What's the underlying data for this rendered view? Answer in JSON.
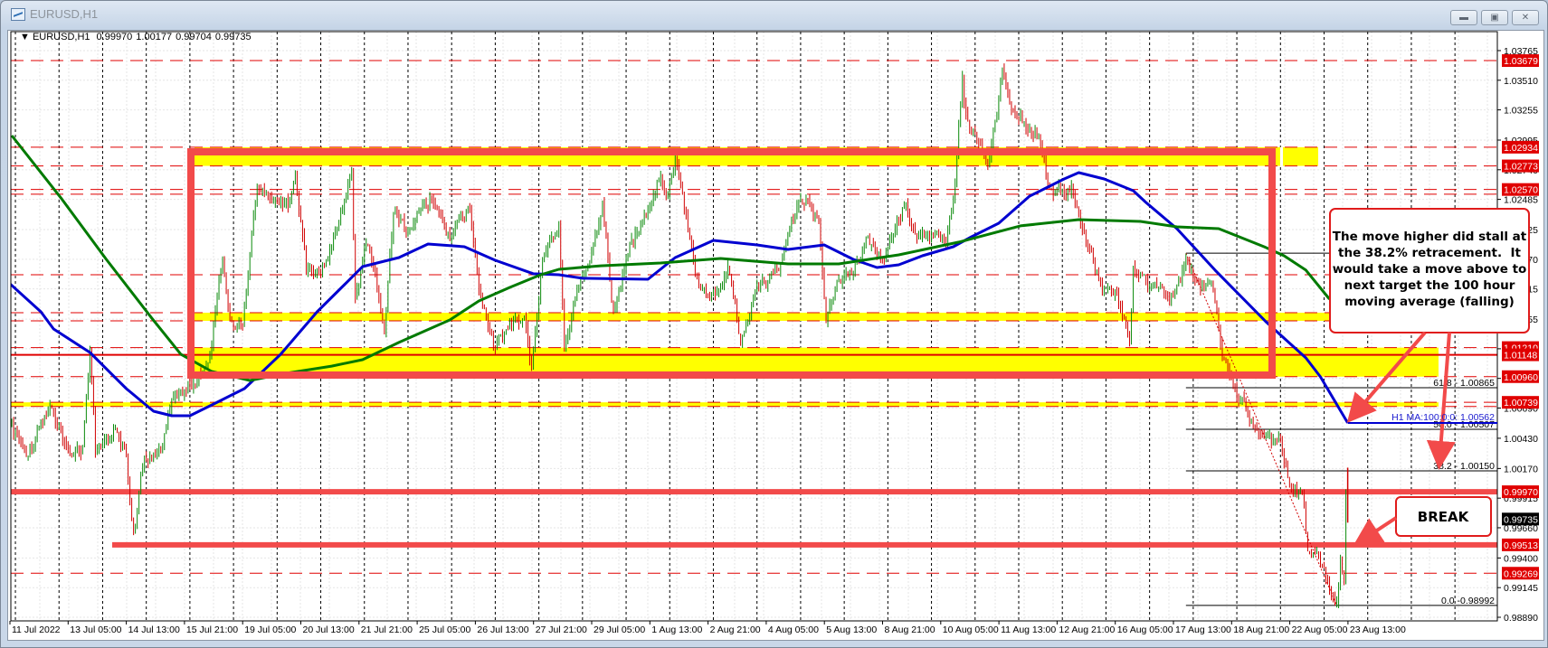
{
  "window": {
    "title": "EURUSD,H1",
    "buttons": {
      "minimize": "minimize-icon",
      "maximize": "maximize-icon",
      "close": "close-icon"
    }
  },
  "chart_data": {
    "type": "bar",
    "bar_style": "ohlc",
    "symbol": "EURUSD,H1",
    "header": {
      "symbol": "EURUSD,H1",
      "open": "0.99970",
      "high": "1.00177",
      "low": "0.99704",
      "close": "0.99735"
    },
    "last_bar": {
      "time": "2022-08-23 13:00",
      "open": 0.9997,
      "high": 1.00177,
      "low": 0.99704,
      "close": 0.99735
    },
    "colors": {
      "up": "#0a8a0a",
      "down": "#d00000",
      "ma100": "#0000d0",
      "ma200": "#007a00",
      "level": "#e00000",
      "zone": "#ffff00",
      "annotation": "#f24a4a"
    },
    "ylim": [
      0.9889,
      1.03765
    ],
    "y_ticks": [
      "1.03765",
      "1.03510",
      "1.03255",
      "1.02995",
      "1.02740",
      "1.02485",
      "1.02225",
      "1.01970",
      "1.01715",
      "1.01455",
      "1.01200",
      "1.00945",
      "1.00690",
      "1.00430",
      "1.00170",
      "0.99915",
      "0.99660",
      "0.99400",
      "0.99145",
      "0.98890"
    ],
    "x_ticks": [
      "11 Jul 2022",
      "13 Jul 05:00",
      "14 Jul 13:00",
      "15 Jul 21:00",
      "19 Jul 05:00",
      "20 Jul 13:00",
      "21 Jul 21:00",
      "25 Jul 05:00",
      "26 Jul 13:00",
      "27 Jul 21:00",
      "29 Jul 05:00",
      "1 Aug 13:00",
      "2 Aug 21:00",
      "4 Aug 05:00",
      "5 Aug 13:00",
      "8 Aug 21:00",
      "10 Aug 05:00",
      "11 Aug 13:00",
      "12 Aug 21:00",
      "16 Aug 05:00",
      "17 Aug 13:00",
      "18 Aug 21:00",
      "22 Aug 05:00",
      "23 Aug 13:00"
    ],
    "grid": true,
    "period_separators": true,
    "price_path": [
      [
        "2022-07-11 21:00",
        1.00546
      ],
      [
        "2022-07-12 06:00",
        1.00274
      ],
      [
        "2022-07-12 19:00",
        1.00702
      ],
      [
        "2022-07-13 05:00",
        1.00313
      ],
      [
        "2022-07-13 13:00",
        1.00352
      ],
      [
        "2022-07-13 17:00",
        1.01168
      ],
      [
        "2022-07-13 20:00",
        1.00313
      ],
      [
        "2022-07-14 06:00",
        1.00507
      ],
      [
        "2022-07-14 13:00",
        1.00274
      ],
      [
        "2022-07-14 17:00",
        0.99613
      ],
      [
        "2022-07-14 23:00",
        1.00274
      ],
      [
        "2022-07-15 08:00",
        1.00313
      ],
      [
        "2022-07-15 15:00",
        1.00779
      ],
      [
        "2022-07-18 03:00",
        1.00896
      ],
      [
        "2022-07-18 11:00",
        1.01129
      ],
      [
        "2022-07-18 15:00",
        1.01635
      ],
      [
        "2022-07-18 18:00",
        1.01946
      ],
      [
        "2022-07-18 22:00",
        1.0144
      ],
      [
        "2022-07-19 05:00",
        1.01401
      ],
      [
        "2022-07-19 11:00",
        1.02334
      ],
      [
        "2022-07-19 13:00",
        1.02606
      ],
      [
        "2022-07-19 21:00",
        1.02451
      ],
      [
        "2022-07-20 06:00",
        1.02412
      ],
      [
        "2022-07-20 10:00",
        1.02684
      ],
      [
        "2022-07-20 16:00",
        1.01868
      ],
      [
        "2022-07-21 00:00",
        1.01829
      ],
      [
        "2022-07-21 09:00",
        1.02218
      ],
      [
        "2022-07-21 17:00",
        1.02723
      ],
      [
        "2022-07-21 19:00",
        1.01635
      ],
      [
        "2022-07-22 01:00",
        1.02101
      ],
      [
        "2022-07-22 06:00",
        1.01868
      ],
      [
        "2022-07-22 11:00",
        1.01324
      ],
      [
        "2022-07-22 16:00",
        1.02373
      ],
      [
        "2022-07-25 00:00",
        1.02218
      ],
      [
        "2022-07-25 13:00",
        1.0249
      ],
      [
        "2022-07-26 00:00",
        1.02179
      ],
      [
        "2022-07-26 10:00",
        1.02412
      ],
      [
        "2022-07-26 15:00",
        1.01712
      ],
      [
        "2022-07-26 23:00",
        1.01207
      ],
      [
        "2022-07-27 09:00",
        1.01401
      ],
      [
        "2022-07-27 16:00",
        1.01479
      ],
      [
        "2022-07-27 20:00",
        1.01051
      ],
      [
        "2022-07-28 02:00",
        1.01984
      ],
      [
        "2022-07-28 11:00",
        1.02295
      ],
      [
        "2022-07-28 14:00",
        1.01207
      ],
      [
        "2022-07-28 20:00",
        1.01635
      ],
      [
        "2022-07-29 03:00",
        1.01907
      ],
      [
        "2022-07-29 11:00",
        1.02451
      ],
      [
        "2022-07-29 17:00",
        1.01518
      ],
      [
        "2022-08-01 02:00",
        1.02101
      ],
      [
        "2022-08-01 11:00",
        1.02334
      ],
      [
        "2022-08-01 18:00",
        1.02645
      ],
      [
        "2022-08-01 23:00",
        1.02529
      ],
      [
        "2022-08-02 03:00",
        1.0284
      ],
      [
        "2022-08-02 10:00",
        1.02218
      ],
      [
        "2022-08-02 16:00",
        1.01751
      ],
      [
        "2022-08-03 01:00",
        1.01673
      ],
      [
        "2022-08-03 08:00",
        1.01907
      ],
      [
        "2022-08-03 15:00",
        1.01246
      ],
      [
        "2022-08-03 23:00",
        1.01697
      ],
      [
        "2022-08-04 12:00",
        1.01868
      ],
      [
        "2022-08-04 19:00",
        1.02334
      ],
      [
        "2022-08-05 03:00",
        1.0249
      ],
      [
        "2022-08-05 10:00",
        1.02295
      ],
      [
        "2022-08-05 14:00",
        1.0144
      ],
      [
        "2022-08-05 20:00",
        1.0179
      ],
      [
        "2022-08-08 08:00",
        1.01946
      ],
      [
        "2022-08-08 12:00",
        1.02163
      ],
      [
        "2022-08-08 21:00",
        1.01946
      ],
      [
        "2022-08-09 09:00",
        1.02428
      ],
      [
        "2022-08-09 17:00",
        1.02163
      ],
      [
        "2022-08-10 08:00",
        1.02117
      ],
      [
        "2022-08-10 13:00",
        1.02645
      ],
      [
        "2022-08-10 15:00",
        1.03112
      ],
      [
        "2022-08-10 17:00",
        1.0354
      ],
      [
        "2022-08-10 19:00",
        1.03228
      ],
      [
        "2022-08-11 01:00",
        1.02995
      ],
      [
        "2022-08-11 07:00",
        1.02778
      ],
      [
        "2022-08-11 12:00",
        1.03228
      ],
      [
        "2022-08-11 15:00",
        1.03617
      ],
      [
        "2022-08-11 20:00",
        1.03267
      ],
      [
        "2022-08-12 03:00",
        1.03151
      ],
      [
        "2022-08-12 11:00",
        1.03034
      ],
      [
        "2022-08-12 15:00",
        1.02684
      ],
      [
        "2022-08-12 19:00",
        1.02529
      ],
      [
        "2022-08-15 05:00",
        1.02606
      ],
      [
        "2022-08-15 13:00",
        1.02101
      ],
      [
        "2022-08-15 23:00",
        1.01712
      ],
      [
        "2022-08-16 06:00",
        1.01673
      ],
      [
        "2022-08-16 13:00",
        1.01261
      ],
      [
        "2022-08-16 15:00",
        1.01907
      ],
      [
        "2022-08-16 23:00",
        1.01728
      ],
      [
        "2022-08-17 10:00",
        1.01635
      ],
      [
        "2022-08-17 17:00",
        1.01775
      ],
      [
        "2022-08-17 20:00",
        1.0196
      ],
      [
        "2022-08-18 03:00",
        1.01775
      ],
      [
        "2022-08-18 11:00",
        1.01712
      ],
      [
        "2022-08-18 16:00",
        1.01129
      ],
      [
        "2022-08-18 23:00",
        1.00857
      ],
      [
        "2022-08-19 09:00",
        1.00546
      ],
      [
        "2022-08-19 19:00",
        1.00391
      ],
      [
        "2022-08-22 00:00",
        1.00406
      ],
      [
        "2022-08-22 05:00",
        1.00041
      ],
      [
        "2022-08-22 12:00",
        0.99963
      ],
      [
        "2022-08-22 15:00",
        0.99458
      ],
      [
        "2022-08-22 21:00",
        0.99419
      ],
      [
        "2022-08-23 02:00",
        0.99224
      ],
      [
        "2022-08-23 07:00",
        0.9902
      ],
      [
        "2022-08-23 09:00",
        0.9938
      ],
      [
        "2022-08-23 11:00",
        0.99224
      ],
      [
        "2022-08-23 12:00",
        0.9997
      ]
    ],
    "series": [
      {
        "name": "H1 MA:100:0:0:",
        "label": "H1 MA:100:0:0: 1.00562",
        "last_value": 1.00562,
        "points": [
          [
            "2022-07-11 21:00",
            1.01759
          ],
          [
            "2022-07-12 14:00",
            1.01518
          ],
          [
            "2022-07-12 21:00",
            1.0137
          ],
          [
            "2022-07-13 17:00",
            1.01168
          ],
          [
            "2022-07-14 13:00",
            1.00857
          ],
          [
            "2022-07-15 04:00",
            1.00663
          ],
          [
            "2022-07-15 14:00",
            1.00624
          ],
          [
            "2022-07-18 00:00",
            1.00624
          ],
          [
            "2022-07-18 15:00",
            1.0074
          ],
          [
            "2022-07-19 06:00",
            1.00857
          ],
          [
            "2022-07-20 02:00",
            1.01153
          ],
          [
            "2022-07-20 22:00",
            1.01518
          ],
          [
            "2022-07-21 13:00",
            1.01751
          ],
          [
            "2022-07-21 23:00",
            1.01907
          ],
          [
            "2022-07-22 19:00",
            1.01984
          ],
          [
            "2022-07-25 11:00",
            1.02101
          ],
          [
            "2022-07-26 07:00",
            1.02078
          ],
          [
            "2022-07-27 00:00",
            1.01961
          ],
          [
            "2022-07-27 21:00",
            1.01845
          ],
          [
            "2022-07-28 11:00",
            1.01837
          ],
          [
            "2022-07-29 00:00",
            1.01806
          ],
          [
            "2022-08-01 12:00",
            1.01798
          ],
          [
            "2022-08-02 03:00",
            1.01984
          ],
          [
            "2022-08-03 00:00",
            1.02132
          ],
          [
            "2022-08-04 00:00",
            1.02093
          ],
          [
            "2022-08-04 17:00",
            1.02054
          ],
          [
            "2022-08-05 13:00",
            1.02093
          ],
          [
            "2022-08-08 05:00",
            1.01969
          ],
          [
            "2022-08-08 18:00",
            1.01899
          ],
          [
            "2022-08-09 06:00",
            1.01922
          ],
          [
            "2022-08-09 19:00",
            1.02
          ],
          [
            "2022-08-10 12:00",
            1.02078
          ],
          [
            "2022-08-10 22:00",
            1.02163
          ],
          [
            "2022-08-11 13:00",
            1.0228
          ],
          [
            "2022-08-12 06:00",
            1.02513
          ],
          [
            "2022-08-15 01:00",
            1.02661
          ],
          [
            "2022-08-15 09:00",
            1.02715
          ],
          [
            "2022-08-15 23:00",
            1.02661
          ],
          [
            "2022-08-16 15:00",
            1.0256
          ],
          [
            "2022-08-16 22:00",
            1.02459
          ],
          [
            "2022-08-17 15:00",
            1.02233
          ],
          [
            "2022-08-18 12:00",
            1.01876
          ],
          [
            "2022-08-19 16:00",
            1.01432
          ],
          [
            "2022-08-22 14:00",
            1.01121
          ],
          [
            "2022-08-22 22:00",
            1.00958
          ],
          [
            "2022-08-23 13:00",
            1.00562
          ]
        ]
      },
      {
        "points": [
          [
            "2022-07-11 22:00",
            1.03034
          ],
          [
            "2022-07-13 01:00",
            1.02498
          ],
          [
            "2022-07-14 02:00",
            1.01969
          ],
          [
            "2022-07-15 03:00",
            1.01464
          ],
          [
            "2022-07-15 19:00",
            1.01153
          ],
          [
            "2022-07-18 12:00",
            1.01005
          ],
          [
            "2022-07-19 09:00",
            1.00927
          ],
          [
            "2022-07-20 05:00",
            1.00989
          ],
          [
            "2022-07-21 06:00",
            1.01051
          ],
          [
            "2022-07-21 23:00",
            1.01106
          ],
          [
            "2022-07-22 19:00",
            1.01254
          ],
          [
            "2022-07-25 23:00",
            1.01448
          ],
          [
            "2022-07-26 15:00",
            1.01611
          ],
          [
            "2022-07-27 08:00",
            1.01728
          ],
          [
            "2022-07-28 01:00",
            1.01837
          ],
          [
            "2022-07-28 11:00",
            1.01883
          ],
          [
            "2022-07-29 10:00",
            1.01914
          ],
          [
            "2022-08-01 19:00",
            1.01938
          ],
          [
            "2022-08-03 04:00",
            1.01977
          ],
          [
            "2022-08-04 17:00",
            1.0193
          ],
          [
            "2022-08-05 21:00",
            1.0193
          ],
          [
            "2022-08-09 06:00",
            1.02008
          ],
          [
            "2022-08-10 15:00",
            1.02117
          ],
          [
            "2022-08-12 01:00",
            1.02257
          ],
          [
            "2022-08-15 09:00",
            1.02311
          ],
          [
            "2022-08-16 19:00",
            1.02295
          ],
          [
            "2022-08-17 15:00",
            1.02249
          ],
          [
            "2022-08-18 14:00",
            1.02233
          ],
          [
            "2022-08-19 15:00",
            1.02078
          ],
          [
            "2022-08-22 02:00",
            1.02
          ],
          [
            "2022-08-22 14:00",
            1.01876
          ],
          [
            "2022-08-23 03:00",
            1.01627
          ]
        ]
      }
    ],
    "levels": [
      {
        "price": 1.03679,
        "label": "1.03679",
        "style": "dashed"
      },
      {
        "price": 1.02934,
        "label": "1.02934",
        "style": "dashed"
      },
      {
        "price": 1.02773,
        "label": "1.02773",
        "style": "dashed"
      },
      {
        "price": 1.0257,
        "label": "1.02570",
        "style": "dashed"
      },
      {
        "price": 1.0121,
        "label": "1.01210",
        "style": "dashed"
      },
      {
        "price": 1.01148,
        "label": "1.01148",
        "style": "solid"
      },
      {
        "price": 1.0096,
        "label": "1.00960",
        "style": "dashed"
      },
      {
        "price": 1.00739,
        "label": "1.00739",
        "style": "dashed"
      },
      {
        "price": 0.9997,
        "label": "0.99970",
        "style": "thick"
      },
      {
        "price": 0.99513,
        "label": "0.99513",
        "style": "thick"
      },
      {
        "price": 0.99269,
        "label": "0.99269",
        "style": "dashed"
      }
    ],
    "levels_unlabeled": [
      1.0253,
      1.01837,
      1.0151,
      1.0144,
      1.00703
    ],
    "zones": [
      [
        1.02773,
        1.02934
      ],
      [
        1.0144,
        1.0151
      ],
      [
        1.0096,
        1.0121
      ],
      [
        1.00703,
        1.00739
      ]
    ],
    "current_price": "0.99735",
    "fibonacci": {
      "from": [
        "2022-08-17 20:00",
        1.02022
      ],
      "to": [
        "2022-08-23 07:00",
        0.98992
      ],
      "levels": [
        {
          "price": 1.02022,
          "label": ""
        },
        {
          "price": 1.00865,
          "label": "61.8 - 1.00865"
        },
        {
          "price": 1.00507,
          "label": "50.0 - 1.00507"
        },
        {
          "price": 1.0015,
          "label": "38.2 - 1.00150"
        },
        {
          "price": 0.98992,
          "label": "0.0 -0.98992"
        }
      ]
    },
    "annotations": {
      "callout_lines": [
        "The move higher did stall at",
        "the 38.2% retracement.  It",
        "would take a move above to",
        "next target the 100 hour",
        "moving average (falling)"
      ],
      "break_label": "BREAK"
    }
  }
}
